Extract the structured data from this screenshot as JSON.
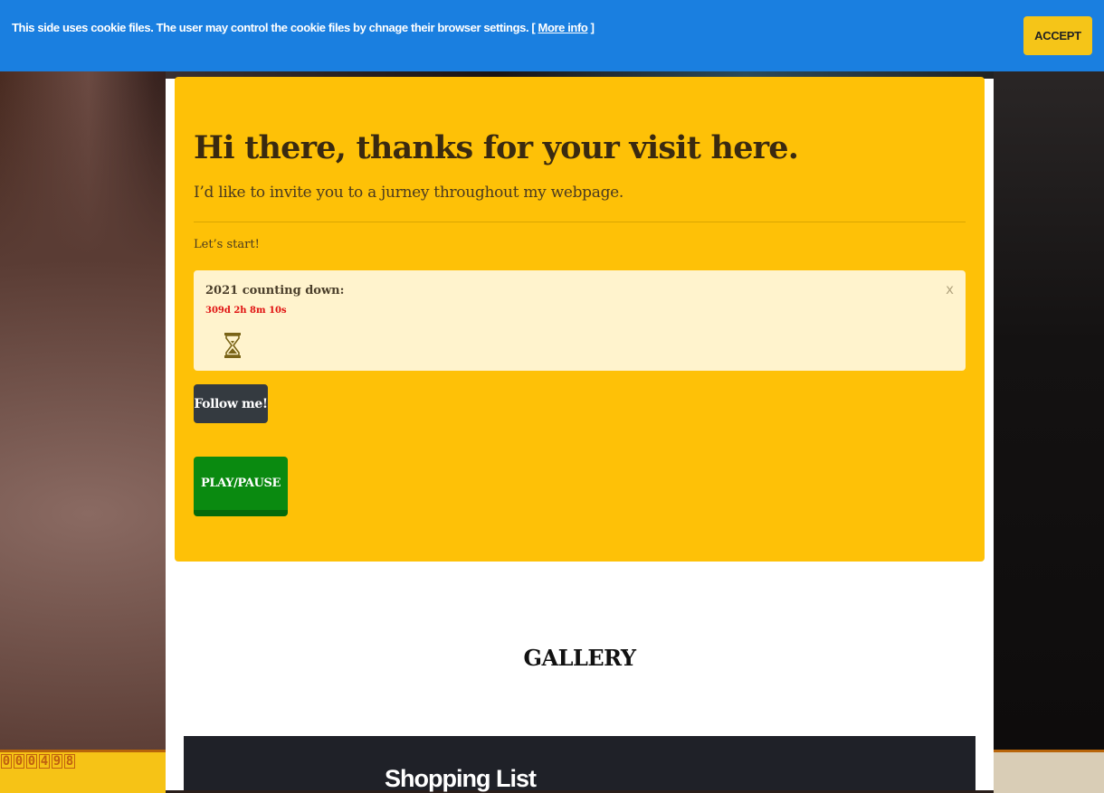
{
  "cookie_bar": {
    "message": "This side uses cookie files. The user may control the cookie files by chnage their browser settings. [",
    "more_info": "More info",
    "close_bracket": "]",
    "accept_label": "ACCEPT"
  },
  "hero": {
    "title": "Hi there, thanks for your visit here.",
    "subtitle": "I’d like to invite you to a jurney throughout my webpage.",
    "lets_start": "Let’s start!"
  },
  "countdown_alert": {
    "title": "2021 counting down:",
    "remaining": "309d 2h 8m 10s",
    "close_symbol": "x",
    "icon": "hourglass-icon"
  },
  "buttons": {
    "follow_label": "Follow me!",
    "play_pause_label": "PLAY/PAUSE"
  },
  "gallery": {
    "title": "GALLERY",
    "panel_title": "Shopping List"
  },
  "hit_counter": {
    "digits": [
      "0",
      "0",
      "0",
      "4",
      "9",
      "8"
    ]
  },
  "colors": {
    "cookie_bar": "#1a7fe0",
    "accept": "#f5c518",
    "jumbotron": "#fec107",
    "alert_bg": "#fff3cd",
    "countdown_text": "#e01010",
    "follow_btn": "#343a40",
    "play_btn": "#0a8a10",
    "shopping_panel": "#1f2128"
  }
}
